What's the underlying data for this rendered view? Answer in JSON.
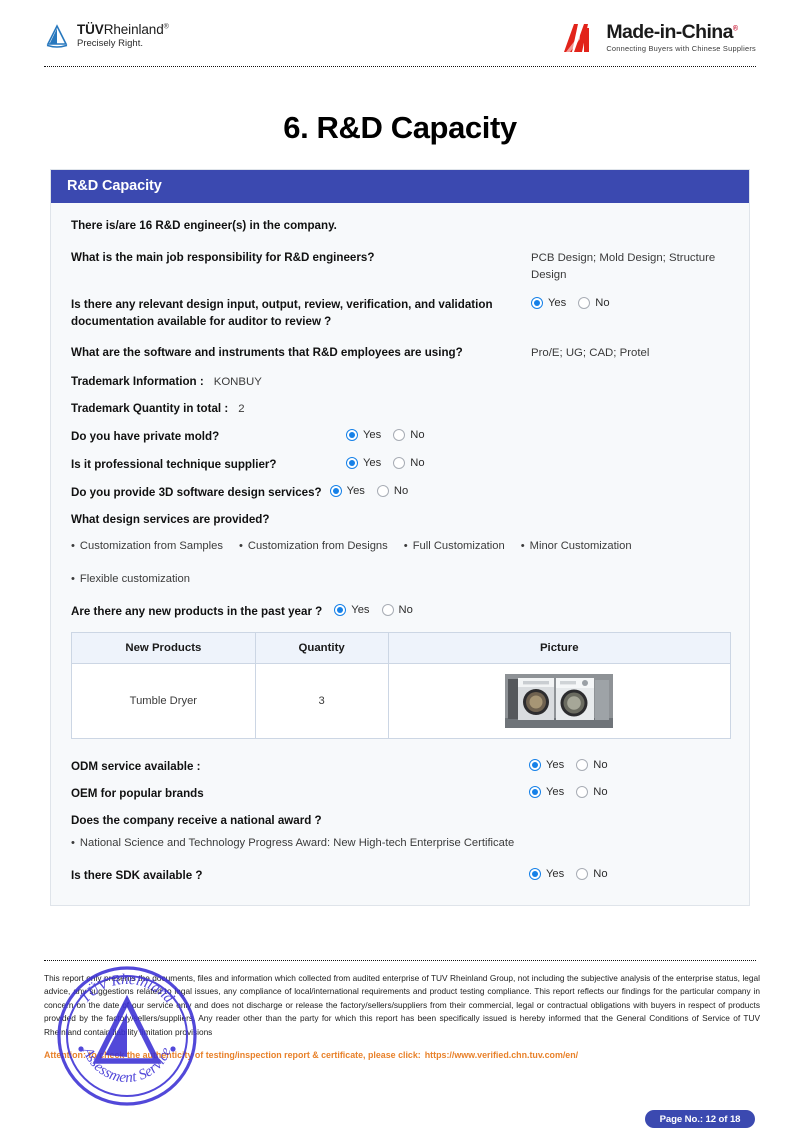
{
  "header": {
    "tuv": {
      "name_bold": "TÜV",
      "name_rest": "Rheinland",
      "registered": "®",
      "tagline": "Precisely Right."
    },
    "mic": {
      "name": "Made-in-China",
      "registered": "®",
      "tagline": "Connecting Buyers with Chinese Suppliers"
    }
  },
  "title": "6. R&D Capacity",
  "panel": {
    "heading": "R&D Capacity",
    "engineer_count_statement": "There is/are 16 R&D engineer(s) in the company.",
    "q_job_responsibility": {
      "question": "What is the main job responsibility for R&D engineers?",
      "answer": "PCB Design; Mold Design; Structure Design"
    },
    "q_design_documentation": {
      "question": "Is there any relevant design input, output, review, verification, and validation documentation available for auditor to review ?",
      "yes": "Yes",
      "no": "No",
      "selected": "Yes"
    },
    "q_software_instruments": {
      "question": "What are the software and instruments that R&D employees are using?",
      "answer": "Pro/E; UG; CAD; Protel"
    },
    "trademark_information": {
      "label": "Trademark Information :",
      "value": "KONBUY"
    },
    "trademark_quantity": {
      "label": "Trademark Quantity in total :",
      "value": "2"
    },
    "q_private_mold": {
      "question": "Do you have private mold?",
      "yes": "Yes",
      "no": "No",
      "selected": "Yes"
    },
    "q_professional_supplier": {
      "question": "Is it professional technique supplier?",
      "yes": "Yes",
      "no": "No",
      "selected": "Yes"
    },
    "q_3d_software": {
      "question": "Do you provide 3D software design services?",
      "yes": "Yes",
      "no": "No",
      "selected": "Yes"
    },
    "q_design_services": {
      "question": "What design services are provided?",
      "items_row1": [
        "Customization from Samples",
        "Customization from Designs",
        "Full Customization",
        "Minor Customization"
      ],
      "items_row2": [
        "Flexible customization"
      ]
    },
    "q_new_products": {
      "question": "Are there any new products in the past year ?",
      "yes": "Yes",
      "no": "No",
      "selected": "Yes"
    },
    "new_products_table": {
      "columns": [
        "New Products",
        "Quantity",
        "Picture"
      ],
      "rows": [
        {
          "product": "Tumble Dryer",
          "quantity": "3",
          "picture": "tumble-dryer-photo"
        }
      ]
    },
    "q_odm_service": {
      "question": "ODM service available :",
      "yes": "Yes",
      "no": "No",
      "selected": "Yes"
    },
    "q_oem_brands": {
      "question": "OEM for popular brands",
      "yes": "Yes",
      "no": "No",
      "selected": "Yes"
    },
    "q_national_award": {
      "question": "Does the company receive a national award ?",
      "items": [
        "National Science and Technology Progress Award: New High-tech Enterprise Certificate"
      ]
    },
    "q_sdk": {
      "question": "Is there SDK available ?",
      "yes": "Yes",
      "no": "No",
      "selected": "Yes"
    }
  },
  "footer": {
    "disclaimer": "This report only presents the documents, files and information which collected from audited enterprise of TUV Rheinland Group, not including the subjective analysis of the enterprise status, legal advice, any suggestions related to legal issues, any compliance of local/international requirements and product testing compliance. This report reflects our findings for the particular company in concern on the date of our service only and does not discharge or release the factory/sellers/suppliers from their commercial, legal or contractual obligations with buyers in respect of products provided by the factory/sellers/suppliers. Any reader other than the party for which this report has been specifically issued is hereby informed that the General Conditions of Service of TUV Rheinland contain liability limitation provisions",
    "attention_text": "Attention: to check the authenticity of testing/inspection report & certificate, please click:",
    "attention_url": "https://www.verified.chn.tuv.com/en/",
    "stamp": {
      "top_text": "TÜV Rheinland",
      "bottom_text": "Assessment Service"
    },
    "page_badge": "Page No.: 12 of 18"
  },
  "colors": {
    "panel_header": "#3b49b0",
    "radio_selected": "#1681e8",
    "attention": "#e8812a",
    "stamp": "#3b2fd4",
    "mic_red": "#e2231a",
    "tuv_blue": "#2878be"
  }
}
